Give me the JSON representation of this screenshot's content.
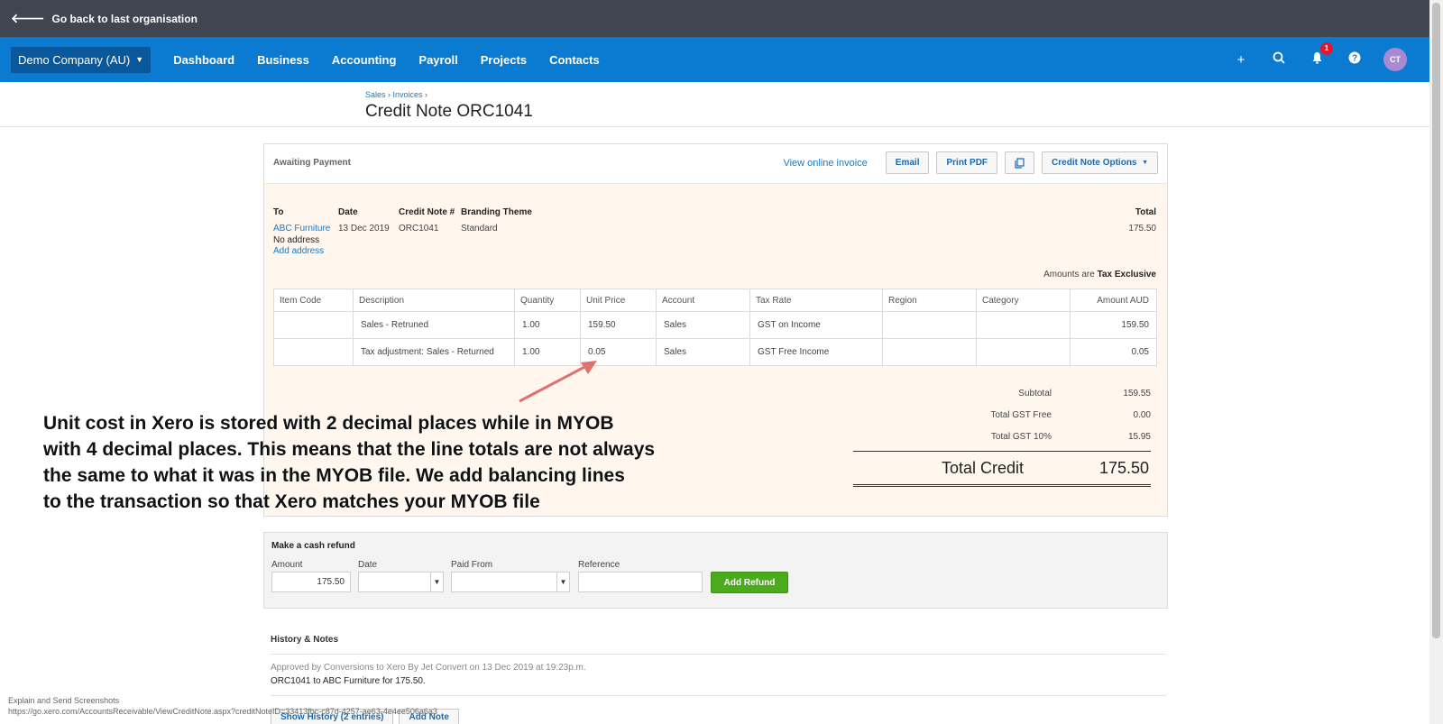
{
  "topbar": {
    "back_label": "Go back to last organisation"
  },
  "nav": {
    "org": "Demo Company (AU)",
    "items": [
      "Dashboard",
      "Business",
      "Accounting",
      "Payroll",
      "Projects",
      "Contacts"
    ],
    "notification_count": "1",
    "avatar": "CT"
  },
  "page": {
    "crumb_sales": "Sales",
    "crumb_invoices": "Invoices",
    "title": "Credit Note ORC1041"
  },
  "toolbar": {
    "status": "Awaiting Payment",
    "view_online": "View online invoice",
    "email": "Email",
    "print": "Print PDF",
    "options": "Credit Note Options"
  },
  "details": {
    "to_label": "To",
    "to_value": "ABC Furniture",
    "no_address": "No address",
    "add_address": "Add address",
    "date_label": "Date",
    "date_value": "13 Dec 2019",
    "credit_label": "Credit Note #",
    "credit_value": "ORC1041",
    "theme_label": "Branding Theme",
    "theme_value": "Standard",
    "total_label": "Total",
    "total_value": "175.50",
    "amounts_are": "Amounts are",
    "tax_mode": "Tax Exclusive"
  },
  "table": {
    "headers": [
      "Item Code",
      "Description",
      "Quantity",
      "Unit Price",
      "Account",
      "Tax Rate",
      "Region",
      "Category",
      "Amount AUD"
    ],
    "rows": [
      [
        "",
        "Sales - Retruned",
        "1.00",
        "159.50",
        "Sales",
        "GST on Income",
        "",
        "",
        "159.50"
      ],
      [
        "",
        "Tax adjustment: Sales - Returned",
        "1.00",
        "0.05",
        "Sales",
        "GST Free Income",
        "",
        "",
        "0.05"
      ]
    ]
  },
  "totals": {
    "subtotal_label": "Subtotal",
    "subtotal": "159.55",
    "gstfree_label": "Total GST Free",
    "gstfree": "0.00",
    "gst_label": "Total GST 10%",
    "gst": "15.95",
    "credit_label": "Total Credit",
    "credit": "175.50"
  },
  "annotation": {
    "line1": "Unit cost in Xero is stored with 2 decimal places while in MYOB",
    "line2": "with 4 decimal places. This means that the line totals are not always",
    "line3": "the same to what it was in the MYOB file. We add balancing lines",
    "line4": "to the transaction so that Xero matches your MYOB file",
    "arrow_color": "#e07070"
  },
  "refund": {
    "title": "Make a cash refund",
    "amount_label": "Amount",
    "amount_value": "175.50",
    "date_label": "Date",
    "paid_from_label": "Paid From",
    "reference_label": "Reference",
    "add_button": "Add Refund"
  },
  "history": {
    "title": "History & Notes",
    "note1": "Approved by Conversions to Xero By Jet Convert on 13 Dec 2019 at 19:23p.m.",
    "note2": "ORC1041 to ABC Furniture for 175.50.",
    "show_history": "Show History (2 entries)",
    "add_note": "Add Note"
  },
  "statusbar": {
    "line1": "Explain and Send Screenshots",
    "line2": "https://go.xero.com/AccountsReceivable/ViewCreditNote.aspx?creditNoteID=33413fbc-c87d-4257-ae63-4e4ee506a6a3"
  },
  "colors": {
    "topbar": "#404550",
    "nav": "#0b7ad1",
    "accent": "#1a7ac1",
    "success": "#4bab1d"
  }
}
